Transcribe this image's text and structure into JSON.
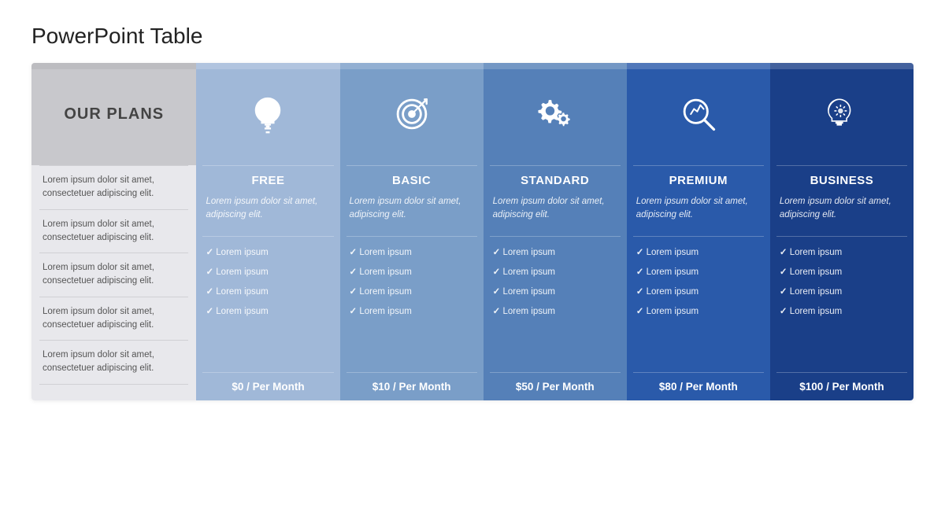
{
  "page": {
    "title": "PowerPoint Table"
  },
  "plans": [
    {
      "id": "free",
      "icon": "lightbulb",
      "name": "FREE",
      "description": "Lorem ipsum dolor sit amet, adipiscing elit.",
      "features": [
        "Lorem ipsum",
        "Lorem ipsum",
        "Lorem ipsum",
        "Lorem ipsum"
      ],
      "price": "$0 / Per Month",
      "colorClass": "col-free"
    },
    {
      "id": "basic",
      "icon": "target",
      "name": "BASIC",
      "description": "Lorem ipsum dolor sit amet, adipiscing elit.",
      "features": [
        "Lorem ipsum",
        "Lorem ipsum",
        "Lorem ipsum",
        "Lorem ipsum"
      ],
      "price": "$10 / Per Month",
      "colorClass": "col-basic"
    },
    {
      "id": "standard",
      "icon": "gears",
      "name": "STANDARD",
      "description": "Lorem ipsum dolor sit amet, adipiscing elit.",
      "features": [
        "Lorem ipsum",
        "Lorem ipsum",
        "Lorem ipsum",
        "Lorem ipsum"
      ],
      "price": "$50 / Per Month",
      "colorClass": "col-standard"
    },
    {
      "id": "premium",
      "icon": "chart-search",
      "name": "PREMIUM",
      "description": "Lorem ipsum dolor sit amet, adipiscing elit.",
      "features": [
        "Lorem ipsum",
        "Lorem ipsum",
        "Lorem ipsum",
        "Lorem ipsum"
      ],
      "price": "$80 / Per Month",
      "colorClass": "col-premium"
    },
    {
      "id": "business",
      "icon": "brain-gears",
      "name": "BUSINESS",
      "description": "Lorem ipsum dolor sit amet, adipiscing elit.",
      "features": [
        "Lorem ipsum",
        "Lorem ipsum",
        "Lorem ipsum",
        "Lorem ipsum"
      ],
      "price": "$100 / Per Month",
      "colorClass": "col-business"
    }
  ],
  "label_col": {
    "title": "OUR PLANS",
    "rows": [
      "Lorem ipsum dolor sit amet, consectetuer adipiscing elit.",
      "Lorem ipsum dolor sit amet, consectetuer adipiscing elit.",
      "Lorem ipsum dolor sit amet, consectetuer adipiscing elit.",
      "Lorem ipsum dolor sit amet, consectetuer adipiscing elit.",
      "Lorem ipsum dolor sit amet, consectetuer adipiscing elit."
    ]
  }
}
